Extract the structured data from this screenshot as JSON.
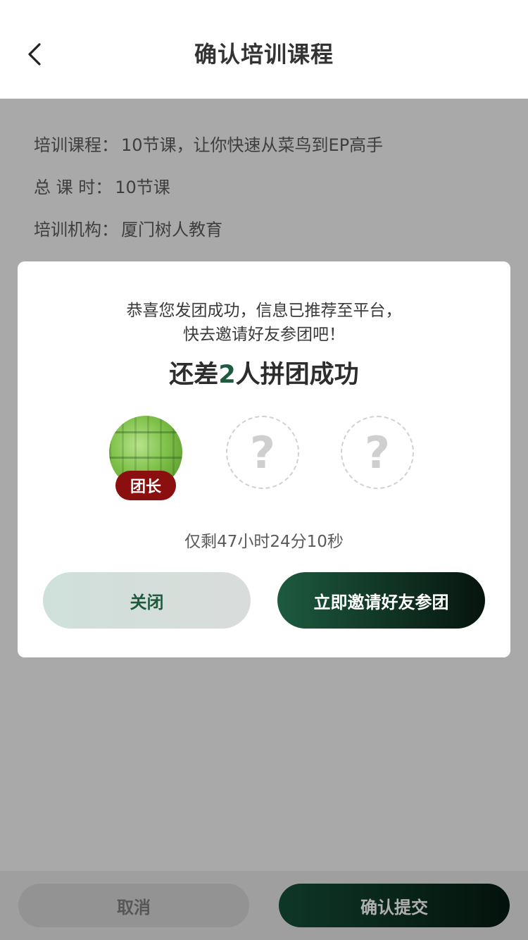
{
  "header": {
    "title": "确认培训课程",
    "back_icon": "chevron-left-icon"
  },
  "info": [
    {
      "label": "培训课程：",
      "value": "10节课，让你快速从菜鸟到EP高手"
    },
    {
      "label": "总 课 时：",
      "value": "10节课"
    },
    {
      "label": "培训机构：",
      "value": "厦门树人教育"
    }
  ],
  "modal": {
    "message_line1": "恭喜您发团成功，信息已推荐至平台，",
    "message_line2": "快去邀请好友参团吧！",
    "headline_prefix": "还差",
    "headline_number": "2",
    "headline_suffix": "人拼团成功",
    "leader_badge": "团长",
    "slot1_symbol": "?",
    "slot2_symbol": "?",
    "timer": "仅剩47小时24分10秒",
    "close_label": "关闭",
    "invite_label": "立即邀请好友参团"
  },
  "bottom": {
    "cancel_label": "取消",
    "confirm_label": "确认提交"
  },
  "colors": {
    "accent": "#1f5a3e",
    "badge": "#8b0f0f"
  }
}
